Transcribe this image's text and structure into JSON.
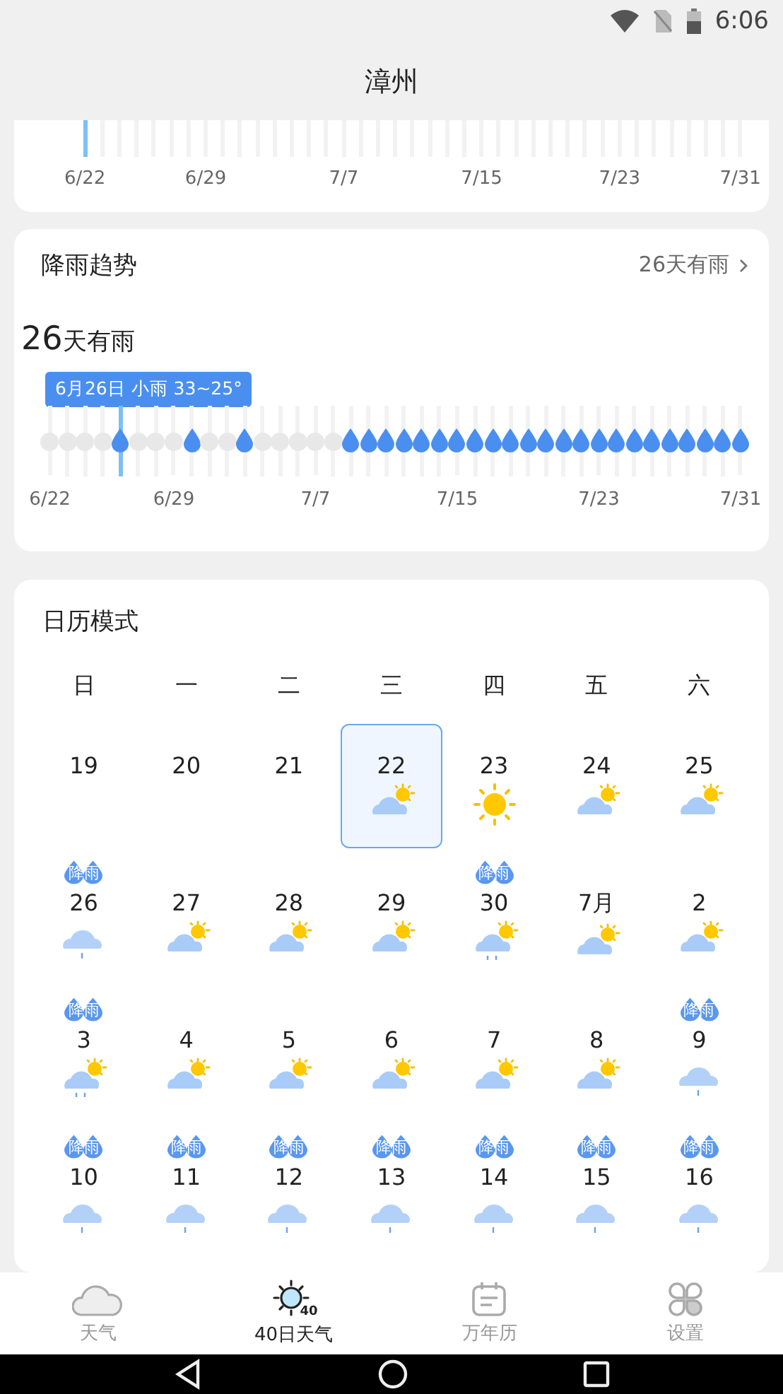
{
  "status_bar": {
    "time": "6:06"
  },
  "header": {
    "title": "漳州"
  },
  "temp_chart": {
    "bars": [
      {
        "selected": true,
        "label": "6/22"
      },
      {
        "selected": false
      },
      {
        "selected": false
      },
      {
        "selected": false
      },
      {
        "selected": false
      },
      {
        "selected": false
      },
      {
        "selected": false
      },
      {
        "selected": false,
        "label": "6/29"
      },
      {
        "selected": false
      },
      {
        "selected": false
      },
      {
        "selected": false
      },
      {
        "selected": false
      },
      {
        "selected": false
      },
      {
        "selected": false
      },
      {
        "selected": false
      },
      {
        "selected": false,
        "label": "7/7"
      },
      {
        "selected": false
      },
      {
        "selected": false
      },
      {
        "selected": false
      },
      {
        "selected": false
      },
      {
        "selected": false
      },
      {
        "selected": false
      },
      {
        "selected": false
      },
      {
        "selected": false,
        "label": "7/15"
      },
      {
        "selected": false
      },
      {
        "selected": false
      },
      {
        "selected": false
      },
      {
        "selected": false
      },
      {
        "selected": false
      },
      {
        "selected": false
      },
      {
        "selected": false
      },
      {
        "selected": false,
        "label": "7/23"
      },
      {
        "selected": false
      },
      {
        "selected": false
      },
      {
        "selected": false
      },
      {
        "selected": false
      },
      {
        "selected": false
      },
      {
        "selected": false
      },
      {
        "selected": false,
        "label": "7/31"
      }
    ]
  },
  "rain_trend": {
    "title": "降雨趋势",
    "link": "26天有雨",
    "count": "26",
    "count_unit": "天有雨",
    "tooltip": "6月26日 小雨 33~25°",
    "days": [
      {
        "rain": false,
        "selected": false,
        "label": "6/22"
      },
      {
        "rain": false,
        "selected": false
      },
      {
        "rain": false,
        "selected": false
      },
      {
        "rain": false,
        "selected": false
      },
      {
        "rain": true,
        "selected": true
      },
      {
        "rain": false,
        "selected": false
      },
      {
        "rain": false,
        "selected": false
      },
      {
        "rain": false,
        "selected": false,
        "label": "6/29"
      },
      {
        "rain": true,
        "selected": false
      },
      {
        "rain": false,
        "selected": false
      },
      {
        "rain": false,
        "selected": false
      },
      {
        "rain": true,
        "selected": false
      },
      {
        "rain": false,
        "selected": false
      },
      {
        "rain": false,
        "selected": false
      },
      {
        "rain": false,
        "selected": false
      },
      {
        "rain": false,
        "selected": false,
        "label": "7/7"
      },
      {
        "rain": false,
        "selected": false
      },
      {
        "rain": true,
        "selected": false
      },
      {
        "rain": true,
        "selected": false
      },
      {
        "rain": true,
        "selected": false
      },
      {
        "rain": true,
        "selected": false
      },
      {
        "rain": true,
        "selected": false
      },
      {
        "rain": true,
        "selected": false
      },
      {
        "rain": true,
        "selected": false,
        "label": "7/15"
      },
      {
        "rain": true,
        "selected": false
      },
      {
        "rain": true,
        "selected": false
      },
      {
        "rain": true,
        "selected": false
      },
      {
        "rain": true,
        "selected": false
      },
      {
        "rain": true,
        "selected": false
      },
      {
        "rain": true,
        "selected": false
      },
      {
        "rain": true,
        "selected": false
      },
      {
        "rain": true,
        "selected": false,
        "label": "7/23"
      },
      {
        "rain": true,
        "selected": false
      },
      {
        "rain": true,
        "selected": false
      },
      {
        "rain": true,
        "selected": false
      },
      {
        "rain": true,
        "selected": false
      },
      {
        "rain": true,
        "selected": false
      },
      {
        "rain": true,
        "selected": false
      },
      {
        "rain": true,
        "selected": false
      },
      {
        "rain": true,
        "selected": false,
        "label": "7/31"
      }
    ]
  },
  "calendar": {
    "title": "日历模式",
    "weekdays": [
      "日",
      "一",
      "二",
      "三",
      "四",
      "五",
      "六"
    ],
    "weeks": [
      [
        {
          "day": "19",
          "kind": "blank",
          "selected": false
        },
        {
          "day": "20",
          "kind": "blank",
          "selected": false
        },
        {
          "day": "21",
          "kind": "blank",
          "selected": false
        },
        {
          "day": "22",
          "kind": "partly",
          "selected": true
        },
        {
          "day": "23",
          "kind": "sun",
          "selected": false
        },
        {
          "day": "24",
          "kind": "partly",
          "selected": false
        },
        {
          "day": "25",
          "kind": "partly",
          "selected": false
        }
      ],
      [
        {
          "day": "26",
          "kind": "rain",
          "badge": "降雨",
          "selected": false
        },
        {
          "day": "27",
          "kind": "partly",
          "selected": false
        },
        {
          "day": "28",
          "kind": "partly",
          "selected": false
        },
        {
          "day": "29",
          "kind": "partly",
          "selected": false
        },
        {
          "day": "30",
          "kind": "partlyrain",
          "badge": "降雨",
          "selected": false
        },
        {
          "day": "7月",
          "kind": "partly",
          "selected": false
        },
        {
          "day": "2",
          "kind": "partly",
          "selected": false
        }
      ],
      [
        {
          "day": "3",
          "kind": "partlyrain",
          "badge": "降雨",
          "selected": false
        },
        {
          "day": "4",
          "kind": "partly",
          "selected": false
        },
        {
          "day": "5",
          "kind": "partly",
          "selected": false
        },
        {
          "day": "6",
          "kind": "partly",
          "selected": false
        },
        {
          "day": "7",
          "kind": "partly",
          "selected": false
        },
        {
          "day": "8",
          "kind": "partly",
          "selected": false
        },
        {
          "day": "9",
          "kind": "rain",
          "badge": "降雨",
          "selected": false
        }
      ],
      [
        {
          "day": "10",
          "kind": "rain",
          "badge": "降雨",
          "selected": false
        },
        {
          "day": "11",
          "kind": "rain",
          "badge": "降雨",
          "selected": false
        },
        {
          "day": "12",
          "kind": "rain",
          "badge": "降雨",
          "selected": false
        },
        {
          "day": "13",
          "kind": "rain",
          "badge": "降雨",
          "selected": false
        },
        {
          "day": "14",
          "kind": "rain",
          "badge": "降雨",
          "selected": false
        },
        {
          "day": "15",
          "kind": "rain",
          "badge": "降雨",
          "selected": false
        },
        {
          "day": "16",
          "kind": "rain",
          "badge": "降雨",
          "selected": false
        }
      ]
    ]
  },
  "bottom_nav": [
    {
      "kind": "weather",
      "label": "天气",
      "selected": false
    },
    {
      "kind": "forty",
      "label": "40日天气",
      "icon_text": "40",
      "selected": true
    },
    {
      "kind": "calendar",
      "label": "万年历",
      "selected": false
    },
    {
      "kind": "settings",
      "label": "设置",
      "selected": false
    }
  ]
}
